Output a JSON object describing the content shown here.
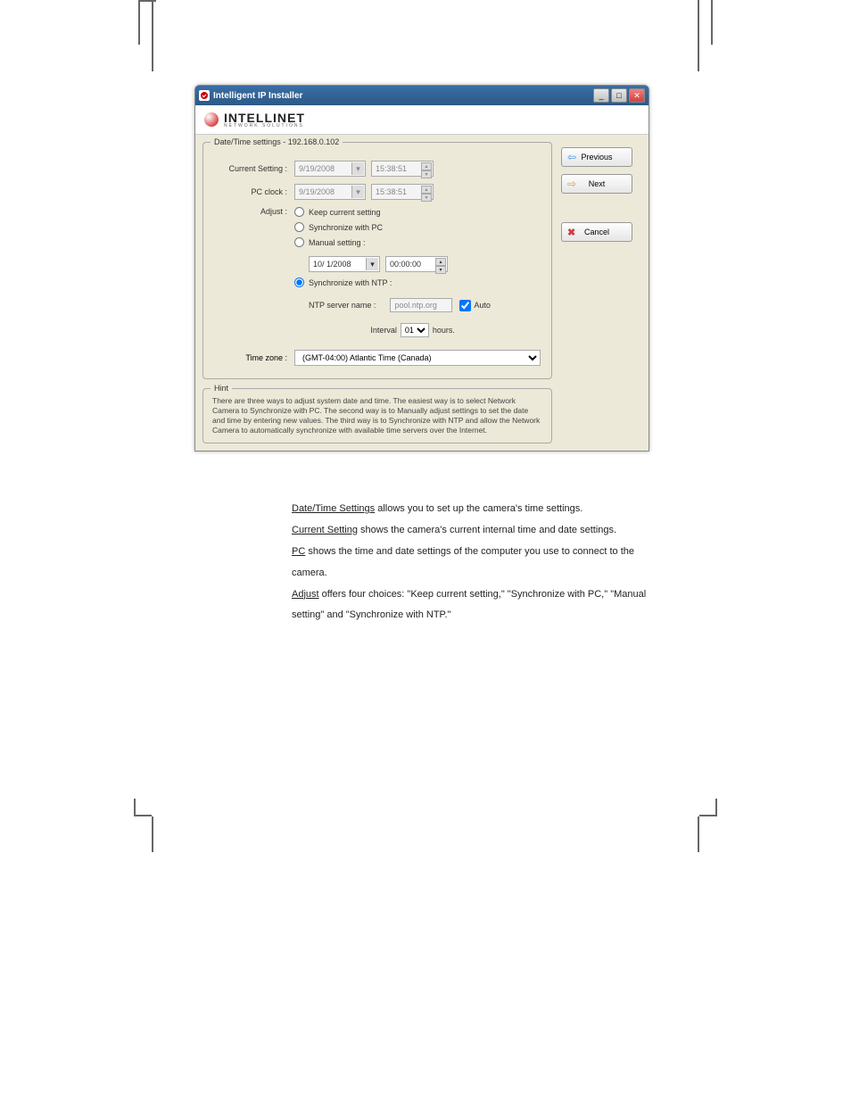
{
  "window": {
    "title": "Intelligent IP Installer"
  },
  "logo": {
    "main": "INTELLINET",
    "sub": "NETWORK SOLUTIONS"
  },
  "fieldset_title": "Date/Time settings - 192.168.0.102",
  "labels": {
    "current_setting": "Current Setting :",
    "pc_clock": "PC clock :",
    "adjust": "Adjust :",
    "time_zone": "Time zone :"
  },
  "current": {
    "date": "9/19/2008",
    "time": "15:38:51"
  },
  "pc": {
    "date": "9/19/2008",
    "time": "15:38:51"
  },
  "adjust": {
    "keep": "Keep current setting",
    "sync_pc": "Synchronize with PC",
    "manual": "Manual setting :",
    "manual_date": "10/ 1/2008",
    "manual_time": "00:00:00",
    "sync_ntp": "Synchronize with NTP :",
    "ntp_label": "NTP server name :",
    "ntp_value": "pool.ntp.org",
    "auto": "Auto",
    "interval_label": "Interval",
    "interval_value": "01",
    "interval_unit": "hours."
  },
  "timezone": "(GMT-04:00) Atlantic Time (Canada)",
  "hint_title": "Hint",
  "hint_text": "There are three ways to adjust system date and time. The easiest way is to select Network Camera to Synchronize with PC. The second way is to Manually adjust settings to set the date and time by entering new values. The third way is to Synchronize with NTP and allow the Network Camera to automatically synchronize with available time servers over the Internet.",
  "buttons": {
    "previous": "Previous",
    "next": "Next",
    "cancel": "Cancel"
  },
  "body": {
    "l1a": "Date/Time Settings",
    "l1b": " allows you to set up the camera's time settings.",
    "l2a": "Current Setting",
    "l2b": " shows the camera's current internal time and date settings.",
    "l3a": "PC",
    "l3b": " shows the time and date settings of the computer you use to connect to the",
    "l4": "camera.",
    "l5a": "Adjust",
    "l5b": " offers four choices: \"Keep current setting,\" \"Synchronize with PC,\" \"Manual",
    "l6": "setting\" and \"Synchronize with NTP.\""
  }
}
